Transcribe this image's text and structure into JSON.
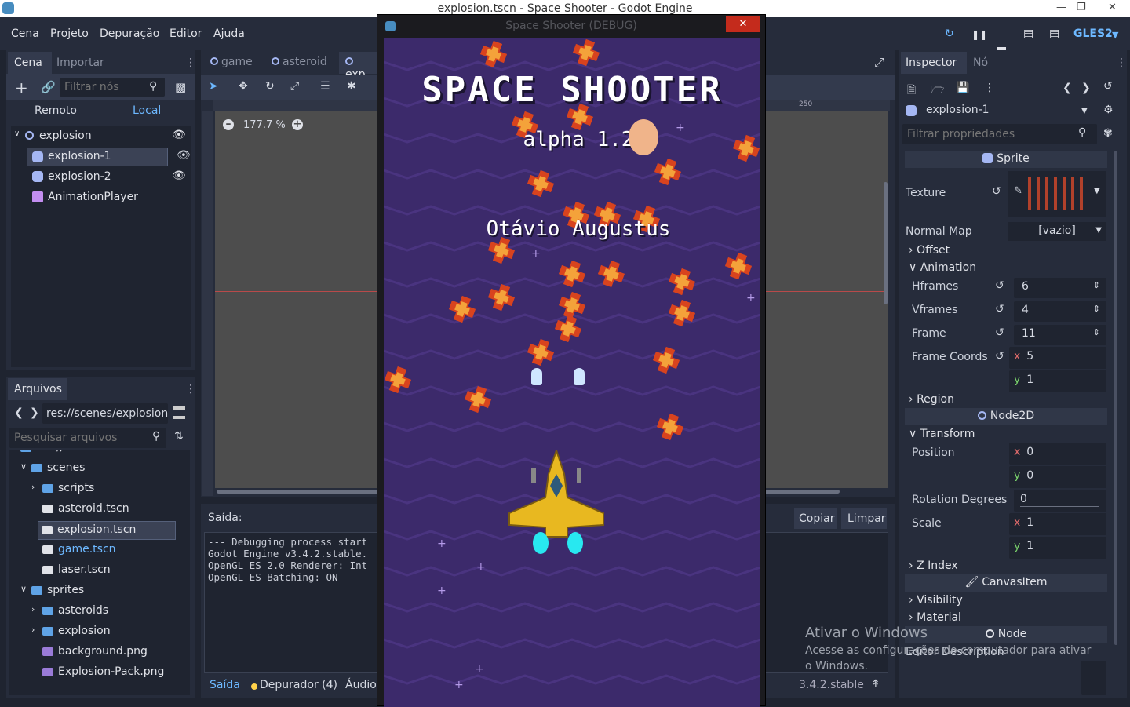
{
  "window": {
    "title": "explosion.tscn - Space Shooter - Godot Engine"
  },
  "menu": [
    "Cena",
    "Projeto",
    "Depuração",
    "Editor",
    "Ajuda"
  ],
  "toolbar": {
    "renderer": "GLES2"
  },
  "scene_dock": {
    "tabs": [
      "Cena",
      "Importar"
    ],
    "filter_placeholder": "Filtrar nós",
    "remote": "Remoto",
    "local": "Local",
    "nodes": [
      {
        "label": "explosion",
        "icon": "node2d-circle-icon"
      },
      {
        "label": "explosion-1",
        "icon": "sprite-icon"
      },
      {
        "label": "explosion-2",
        "icon": "sprite-icon"
      },
      {
        "label": "AnimationPlayer",
        "icon": "animation-player-icon"
      }
    ]
  },
  "files_dock": {
    "tab": "Arquivos",
    "path": "res://scenes/explosion",
    "search_placeholder": "Pesquisar arquivos",
    "items": [
      {
        "label": "res://",
        "type": "folder",
        "level": 0
      },
      {
        "label": "scenes",
        "type": "folder",
        "level": 1
      },
      {
        "label": "scripts",
        "type": "folder",
        "level": 2
      },
      {
        "label": "asteroid.tscn",
        "type": "scene",
        "level": 2
      },
      {
        "label": "explosion.tscn",
        "type": "scene",
        "level": 2
      },
      {
        "label": "game.tscn",
        "type": "scene",
        "level": 2
      },
      {
        "label": "laser.tscn",
        "type": "scene",
        "level": 2
      },
      {
        "label": "sprites",
        "type": "folder",
        "level": 1
      },
      {
        "label": "asteroids",
        "type": "folder",
        "level": 2
      },
      {
        "label": "explosion",
        "type": "folder",
        "level": 2
      },
      {
        "label": "background.png",
        "type": "image",
        "level": 2
      },
      {
        "label": "Explosion-Pack.png",
        "type": "image",
        "level": 2
      }
    ]
  },
  "editor": {
    "scene_tabs": [
      "game",
      "asteroid",
      "exp"
    ],
    "zoom": "177.7 %",
    "ruler_mark": "250"
  },
  "output": {
    "title": "Saída:",
    "copy": "Copiar",
    "clear": "Limpar",
    "lines": [
      "--- Debugging process start",
      "Godot Engine v3.4.2.stable.",
      "OpenGL ES 2.0 Renderer: Int",
      "OpenGL ES Batching: ON"
    ],
    "bottom_tabs": [
      "Saída",
      "Depurador (4)",
      "Áudio"
    ],
    "version": "3.4.2.stable"
  },
  "game_window": {
    "title": "Space Shooter (DEBUG)",
    "game_title": "SPACE SHOOTER",
    "version": "alpha 1.2",
    "author": "Otávio Augustus"
  },
  "inspector": {
    "tabs": [
      "Inspector",
      "Nó"
    ],
    "object": "explosion-1",
    "filter_placeholder": "Filtrar propriedades",
    "sprite_header": "Sprite",
    "texture_label": "Texture",
    "normal_map_label": "Normal Map",
    "normal_map_value": "[vazio]",
    "offset": "Offset",
    "animation": "Animation",
    "hframes_label": "Hframes",
    "hframes": "6",
    "vframes_label": "Vframes",
    "vframes": "4",
    "frame_label": "Frame",
    "frame": "11",
    "frame_coords_label": "Frame Coords",
    "frame_coords_x": "5",
    "frame_coords_y": "1",
    "region": "Region",
    "node2d_header": "Node2D",
    "transform": "Transform",
    "position_label": "Position",
    "position_x": "0",
    "position_y": "0",
    "rotation_label": "Rotation Degrees",
    "rotation": "0",
    "scale_label": "Scale",
    "scale_x": "1",
    "scale_y": "1",
    "zindex": "Z Index",
    "canvasitem_header": "CanvasItem",
    "visibility": "Visibility",
    "material": "Material",
    "node_header": "Node",
    "editor_description": "Editor Description",
    "x": "x",
    "y": "y"
  },
  "watermark": {
    "title": "Ativar o Windows",
    "text": "Acesse as configurações do computador para ativar o Windows."
  }
}
